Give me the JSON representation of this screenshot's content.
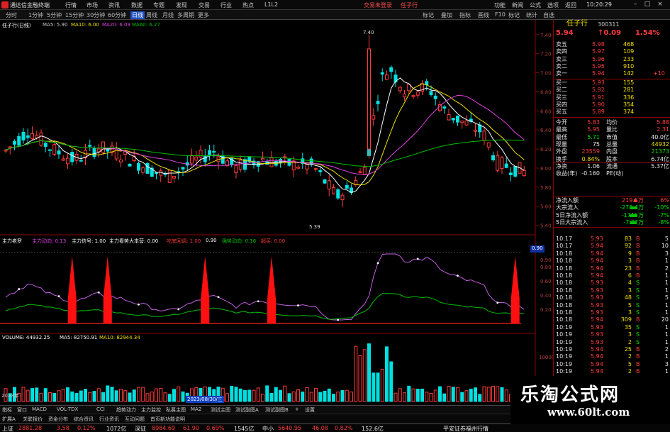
{
  "app": {
    "title": "通达信金融终端",
    "menus": [
      "行情",
      "市场",
      "资讯",
      "数据",
      "专题",
      "发现",
      "交易",
      "行业",
      "热点",
      "L1L2"
    ],
    "top_links": [
      "交易未登录",
      "任子行"
    ],
    "right_menus": [
      "功能",
      "新闻",
      "公式",
      "选项",
      "返回"
    ],
    "clock": "10:20:29"
  },
  "toolbar": {
    "periods": [
      "分时",
      "1分钟",
      "5分钟",
      "15分钟",
      "30分钟",
      "60分钟",
      "日线",
      "周线",
      "月线",
      "多周期",
      "更多"
    ],
    "active_period": "日线",
    "right_tools": [
      "标记",
      "叠加",
      "指标",
      "画线",
      "F10",
      "标记",
      "统计",
      "自选"
    ]
  },
  "main_chart": {
    "title": "任子行(日线)",
    "ma_labels": [
      {
        "text": "MA5: 5.90",
        "color": "#ffffff"
      },
      {
        "text": "MA10: 6.00",
        "color": "#f0e000"
      },
      {
        "text": "MA20: 6.09",
        "color": "#e040e0"
      },
      {
        "text": "MA60: 6.27",
        "color": "#00c000"
      }
    ],
    "high_label": "7.40",
    "low_label": "5.39",
    "price_axis": [
      "7.40",
      "7.20",
      "7.00",
      "6.80",
      "6.60",
      "6.40",
      "6.20",
      "6.00",
      "5.80",
      "5.60",
      "5.40"
    ]
  },
  "indicator": {
    "title": "主力老罗",
    "labels": [
      {
        "text": "主力动向: 0.13",
        "color": "#e040e0"
      },
      {
        "text": "主力信号: 1.00",
        "color": "#ffffff"
      },
      {
        "text": "主力看势大本营: 0.00",
        "color": "#ffffff"
      },
      {
        "text": "吃底回调: 1.00",
        "color": "#ff3b3b"
      },
      {
        "text": "0.90",
        "color": "#ffffff"
      },
      {
        "text": "强势动向: 0.16",
        "color": "#00c000"
      },
      {
        "text": "超买: 0.00",
        "color": "#ff3b3b"
      }
    ],
    "axis": [
      "0.90",
      "0.80",
      "0.60",
      "0.40",
      "0.20"
    ],
    "current_value": "0.90"
  },
  "volume": {
    "labels": [
      {
        "text": "VOLUME: 44932.25",
        "color": "#ffffff"
      },
      {
        "text": "MA5: 82750.91",
        "color": "#ffffff"
      },
      {
        "text": "MA10: 82944.34",
        "color": "#f0e000"
      }
    ],
    "axis": [
      "10000",
      "5000"
    ],
    "date_marker": "2023/08/30/三",
    "year_label": "2023年"
  },
  "quote": {
    "name": "任子行",
    "code": "300311",
    "price": "5.94",
    "change": "↑0.09",
    "change_pct": "1.54%",
    "asks": [
      {
        "label": "卖五",
        "price": "5.98",
        "vol": "468"
      },
      {
        "label": "卖四",
        "price": "5.97",
        "vol": "109"
      },
      {
        "label": "卖三",
        "price": "5.96",
        "vol": "233"
      },
      {
        "label": "卖二",
        "price": "5.95",
        "vol": "910"
      },
      {
        "label": "卖一",
        "price": "5.94",
        "vol": "142"
      }
    ],
    "ask1_change": "+10",
    "bids": [
      {
        "label": "买一",
        "price": "5.93",
        "vol": "155"
      },
      {
        "label": "买二",
        "price": "5.92",
        "vol": "281"
      },
      {
        "label": "买三",
        "price": "5.91",
        "vol": "336"
      },
      {
        "label": "买四",
        "price": "5.90",
        "vol": "354"
      },
      {
        "label": "买五",
        "price": "5.89",
        "vol": "374"
      }
    ],
    "stats": [
      {
        "l1": "今开",
        "v1": "5.83",
        "l2": "均价",
        "v2": "5.88"
      },
      {
        "l1": "最高",
        "v1": "5.95",
        "l2": "量比",
        "v2": "2.31"
      },
      {
        "l1": "最低",
        "v1": "5.71",
        "l2": "市值",
        "v2": "40.0亿"
      },
      {
        "l1": "现量",
        "v1": "75",
        "l2": "总量",
        "v2": "44932"
      },
      {
        "l1": "外盘",
        "v1": "23559",
        "l2": "内盘",
        "v2": "21373"
      },
      {
        "l1": "换手",
        "v1": "0.84%",
        "l2": "股本",
        "v2": "6.74亿"
      },
      {
        "l1": "净资",
        "v1": "1.06",
        "l2": "流通",
        "v2": "5.37亿"
      },
      {
        "l1": "收益(年)",
        "v1": "-0.160",
        "l2": "PE(动)",
        "v2": ""
      }
    ],
    "flows": [
      {
        "label": "净流入额",
        "value": "219.5万",
        "pct": "6%"
      },
      {
        "label": "大宗流入",
        "value": "-278.4万",
        "pct": "-10%"
      },
      {
        "label": "5日净流入额",
        "value": "-1715万",
        "pct": "-7%"
      },
      {
        "label": "5日大宗流入",
        "value": "-7.27万",
        "pct": "-8%"
      }
    ],
    "ticks": [
      {
        "t": "10:17",
        "p": "5.93",
        "v": "83",
        "s": "B",
        "n": "5"
      },
      {
        "t": "10:17",
        "p": "5.94",
        "v": "92",
        "s": "B",
        "n": "10"
      },
      {
        "t": "10:18",
        "p": "5.94",
        "v": "9",
        "s": "B",
        "n": "3"
      },
      {
        "t": "10:18",
        "p": "5.94",
        "v": "3",
        "s": "B",
        "n": "1"
      },
      {
        "t": "10:18",
        "p": "5.94",
        "v": "23",
        "s": "B",
        "n": "2"
      },
      {
        "t": "10:18",
        "p": "5.94",
        "v": "6",
        "s": "B",
        "n": "1"
      },
      {
        "t": "10:18",
        "p": "5.93",
        "v": "4",
        "s": "S",
        "n": "1"
      },
      {
        "t": "10:18",
        "p": "5.93",
        "v": "3",
        "s": "S",
        "n": "1"
      },
      {
        "t": "10:18",
        "p": "5.93",
        "v": "48",
        "s": "S",
        "n": "5"
      },
      {
        "t": "10:18",
        "p": "5.93",
        "v": "5",
        "s": "S",
        "n": "1"
      },
      {
        "t": "10:18",
        "p": "5.93",
        "v": "3",
        "s": "S",
        "n": "1"
      },
      {
        "t": "10:18",
        "p": "5.94",
        "v": "309",
        "s": "B",
        "n": "20"
      },
      {
        "t": "10:19",
        "p": "5.93",
        "v": "35",
        "s": "S",
        "n": "1"
      },
      {
        "t": "10:19",
        "p": "5.93",
        "v": "3",
        "s": "S",
        "n": "1"
      },
      {
        "t": "10:19",
        "p": "5.93",
        "v": "2",
        "s": "S",
        "n": "1"
      },
      {
        "t": "10:19",
        "p": "5.94",
        "v": "25",
        "s": "B",
        "n": "2"
      },
      {
        "t": "10:19",
        "p": "5.94",
        "v": "2",
        "s": "B",
        "n": "1"
      },
      {
        "t": "10:19",
        "p": "5.94",
        "v": "5",
        "s": "B",
        "n": "3"
      },
      {
        "t": "10:19",
        "p": "5.94",
        "v": "2",
        "s": "B",
        "n": "1"
      },
      {
        "t": "10:19",
        "p": "5.94",
        "v": "75",
        "s": "B",
        "n": "3"
      }
    ]
  },
  "bottom_tabs": [
    "指标",
    "窗口",
    "MACD",
    "VOL-TDX",
    "CCI",
    "趋势动力",
    "主力监控",
    "私募主图",
    "MA2",
    "测试主图",
    "测试副图A",
    "测试副图B",
    "+",
    "设置"
  ],
  "bottom_tabs2": [
    "扩展A",
    "关联报价",
    "资金分布",
    "综合资讯",
    "行业资讯",
    "互动问题",
    "首页新功能说明"
  ],
  "status": [
    {
      "name": "上证",
      "value": "2881.28",
      "chg": "3.58",
      "pct": "0.12%",
      "amt": "1072亿"
    },
    {
      "name": "深证",
      "value": "8984.69",
      "chg": "61.90",
      "pct": "0.69%",
      "amt": "1545亿"
    },
    {
      "name": "中小",
      "value": "5640.95",
      "chg": "46.08",
      "pct": "0.82%",
      "amt": "152.6亿"
    }
  ],
  "status_right": "平安证券福州行情",
  "watermark": {
    "title": "乐淘公式网",
    "url": "www.60lt.com"
  },
  "colors": {
    "up": "#ff3b3b",
    "down": "#00ffff",
    "ma5": "#ffffff",
    "ma10": "#f0e000",
    "ma20": "#e040e0",
    "ma60": "#00c000",
    "border": "#8b0000"
  }
}
